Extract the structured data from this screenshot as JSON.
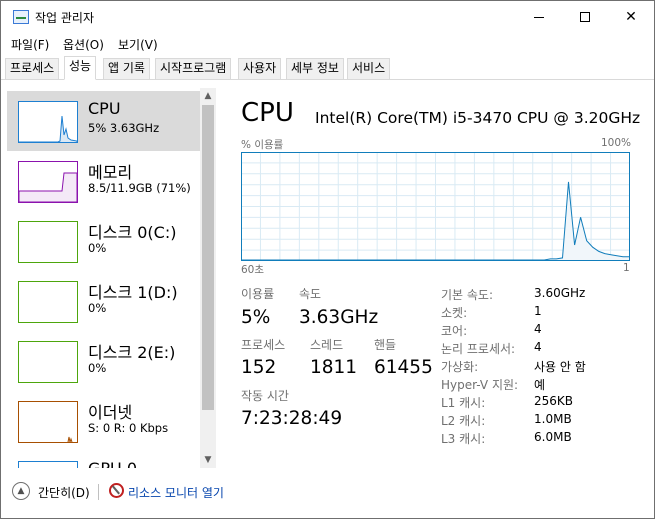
{
  "window": {
    "title": "작업 관리자",
    "controls": {
      "minimize": "min",
      "maximize": "max",
      "close": "✕"
    }
  },
  "menu": [
    "파일(F)",
    "옵션(O)",
    "보기(V)"
  ],
  "tabs": [
    {
      "label": "프로세스",
      "active": false
    },
    {
      "label": "성능",
      "active": true
    },
    {
      "label": "앱 기록",
      "active": false
    },
    {
      "label": "시작프로그램",
      "active": false
    },
    {
      "label": "사용자",
      "active": false
    },
    {
      "label": "세부 정보",
      "active": false
    },
    {
      "label": "서비스",
      "active": false
    }
  ],
  "sidebar": {
    "items": [
      {
        "title": "CPU",
        "sub": "5% 3.63GHz",
        "color": "#1d7fd1",
        "selected": true
      },
      {
        "title": "메모리",
        "sub": "8.5/11.9GB (71%)",
        "color": "#8b12ae",
        "selected": false
      },
      {
        "title": "디스크 0(C:)",
        "sub": "0%",
        "color": "#4da60c",
        "selected": false
      },
      {
        "title": "디스크 1(D:)",
        "sub": "0%",
        "color": "#4da60c",
        "selected": false
      },
      {
        "title": "디스크 2(E:)",
        "sub": "0%",
        "color": "#4da60c",
        "selected": false
      },
      {
        "title": "이더넷",
        "sub": "S: 0 R: 0 Kbps",
        "color": "#a74f01",
        "selected": false
      },
      {
        "title": "GPU 0",
        "sub": "",
        "color": "#1d7fd1",
        "selected": false
      }
    ]
  },
  "cpu": {
    "heading": "CPU",
    "model": "Intel(R) Core(TM) i5-3470 CPU @ 3.20GHz",
    "graph": {
      "label_left": "% 이용률",
      "label_right": "100%",
      "foot_left": "60초",
      "foot_right": "1",
      "line_color": "#117dbb",
      "fill_color": "#f1f6fa",
      "grid_color": "#d9eaf4",
      "usage_percent": [
        0,
        0,
        0,
        0,
        0,
        0,
        0,
        0,
        0,
        0,
        0,
        0,
        0,
        0,
        0,
        0,
        0,
        0,
        0,
        0,
        0,
        0,
        0,
        0,
        0,
        0,
        0,
        0,
        0,
        0,
        0,
        0,
        0,
        0,
        0,
        0,
        0,
        0,
        0,
        0,
        0,
        0,
        0,
        0,
        0,
        0,
        0,
        0,
        0,
        0,
        0,
        1,
        1,
        2,
        73,
        14,
        40,
        18,
        12,
        8,
        6,
        5,
        4,
        3,
        3
      ]
    },
    "stats": {
      "utilization_label": "이용률",
      "utilization": "5%",
      "speed_label": "속도",
      "speed": "3.63GHz",
      "processes_label": "프로세스",
      "processes": "152",
      "threads_label": "스레드",
      "threads": "1811",
      "handles_label": "핸들",
      "handles": "61455",
      "uptime_label": "작동 시간",
      "uptime": "7:23:28:49"
    },
    "info": [
      {
        "label": "기본 속도:",
        "value": "3.60GHz"
      },
      {
        "label": "소켓:",
        "value": "1"
      },
      {
        "label": "코어:",
        "value": "4"
      },
      {
        "label": "논리 프로세서:",
        "value": "4"
      },
      {
        "label": "가상화:",
        "value": "사용 안 함"
      },
      {
        "label": "Hyper-V 지원:",
        "value": "예"
      },
      {
        "label": "L1 캐시:",
        "value": "256KB"
      },
      {
        "label": "L2 캐시:",
        "value": "1.0MB"
      },
      {
        "label": "L3 캐시:",
        "value": "6.0MB"
      }
    ]
  },
  "footer": {
    "collapse_label": "간단히(D)",
    "resource_monitor_label": "리소스 모니터 열기"
  }
}
